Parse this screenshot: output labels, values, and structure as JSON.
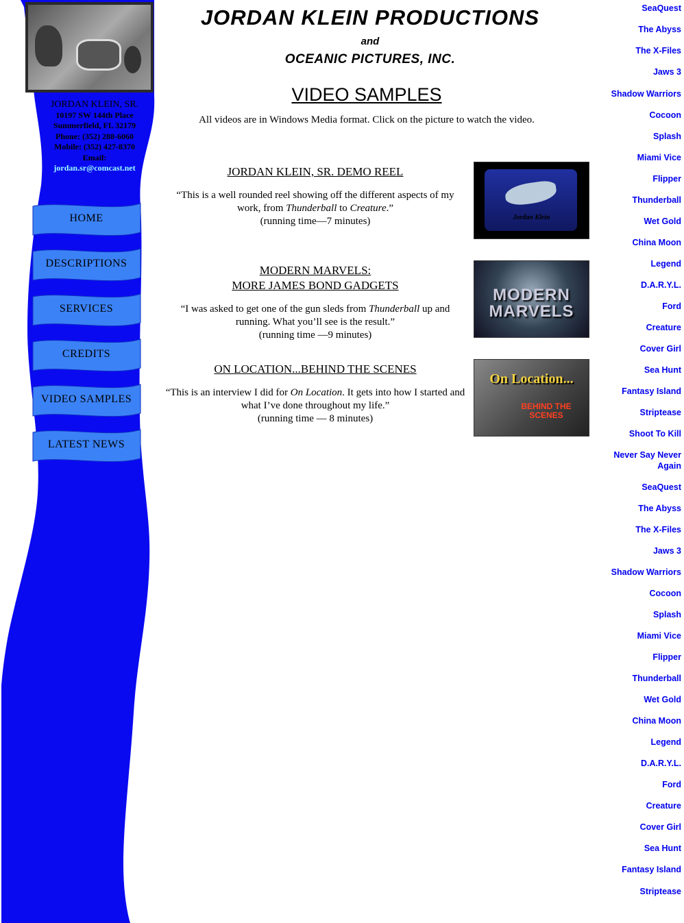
{
  "contact": {
    "name": "JORDAN KLEIN, SR.",
    "address": "10197 SW 144th Place",
    "city": "Summerfield, FL  32179",
    "phone": "Phone:  (352) 288-6060",
    "mobile": "Mobile: (352) 427-8370",
    "email_label": "Email:",
    "email": "jordan.sr@comcast.net"
  },
  "nav": [
    "HOME",
    "DESCRIPTIONS",
    "SERVICES",
    "CREDITS",
    "VIDEO SAMPLES",
    "LATEST NEWS"
  ],
  "header": {
    "company": "JORDAN KLEIN PRODUCTIONS",
    "and": "and",
    "company2": "OCEANIC PICTURES, INC.",
    "page_title": "VIDEO SAMPLES",
    "intro": "All videos are in Windows Media format.  Click on the picture to watch the video."
  },
  "videos": [
    {
      "title": "JORDAN KLEIN, SR. DEMO REEL",
      "title2": "",
      "desc_a": "“This is a well rounded reel showing off the different aspects of my work, from ",
      "desc_i1": "Thunderball",
      "desc_b": " to ",
      "desc_i2": "Creature",
      "desc_c": ".”",
      "runtime": "(running time—7 minutes)",
      "thumb_caption": "Jordan Klein"
    },
    {
      "title": "MODERN MARVELS:",
      "title2": "MORE JAMES BOND GADGETS",
      "desc_a": "“I was asked to get one of the gun sleds from ",
      "desc_i1": "Thunderball",
      "desc_b": " up and running.  What you’ll see is the result.”",
      "desc_i2": "",
      "desc_c": "",
      "runtime": "(running time —9 minutes)",
      "thumb_caption": "MODERN MARVELS"
    },
    {
      "title": "ON LOCATION...BEHIND THE SCENES",
      "title2": "",
      "desc_a": "“This is an interview I did for ",
      "desc_i1": "On Location",
      "desc_b": ".  It gets into how I started and what I’ve done throughout my life.”",
      "desc_i2": "",
      "desc_c": "",
      "runtime": "(running time — 8 minutes)",
      "thumb_caption": "On Location...",
      "thumb_caption2": "BEHIND THE SCENES"
    }
  ],
  "credits_links": [
    "SeaQuest",
    "The Abyss",
    "The X-Files",
    "Jaws 3",
    "Shadow Warriors",
    "Cocoon",
    "Splash",
    "Miami Vice",
    "Flipper",
    "Thunderball",
    "Wet Gold",
    "China Moon",
    "Legend",
    "D.A.R.Y.L.",
    "Ford",
    "Creature",
    "Cover Girl",
    "Sea Hunt",
    "Fantasy Island",
    "Striptease",
    "Shoot To Kill",
    "Never Say Never Again",
    "SeaQuest",
    "The Abyss",
    "The X-Files",
    "Jaws 3",
    "Shadow Warriors",
    "Cocoon",
    "Splash",
    "Miami Vice",
    "Flipper",
    "Thunderball",
    "Wet Gold",
    "China Moon",
    "Legend",
    "D.A.R.Y.L.",
    "Ford",
    "Creature",
    "Cover Girl",
    "Sea Hunt",
    "Fantasy Island",
    "Striptease"
  ],
  "colors": {
    "wave": "#0000ff",
    "button": "#3a7ef0",
    "link": "#0000ee"
  }
}
